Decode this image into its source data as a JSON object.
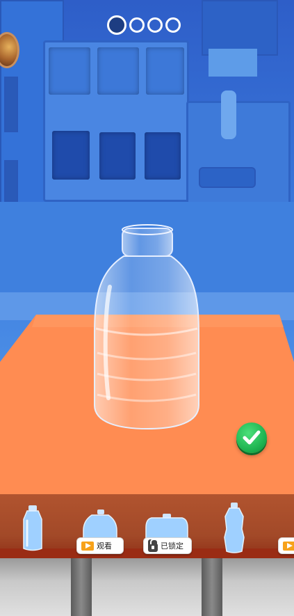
{
  "progress": {
    "total": 4,
    "current": 1
  },
  "selector": {
    "items": [
      {
        "name": "tall-bottle",
        "badge": null
      },
      {
        "name": "jug-bottle",
        "badge": {
          "type": "video",
          "label": "观看"
        }
      },
      {
        "name": "wide-bottle",
        "badge": {
          "type": "lock",
          "label": "已锁定"
        }
      },
      {
        "name": "slim-bottle",
        "badge": null
      },
      {
        "name": "partial-bottle",
        "badge": {
          "type": "video",
          "label": ""
        }
      }
    ],
    "watch_label": "观看",
    "locked_label": "已锁定"
  },
  "colors": {
    "table": "#ff8c52",
    "selector_bar": "#a84a2a",
    "confirm": "#1fb552"
  },
  "icons": {
    "confirm": "checkmark-icon",
    "watch": "video-play-icon",
    "locked": "padlock-icon"
  }
}
